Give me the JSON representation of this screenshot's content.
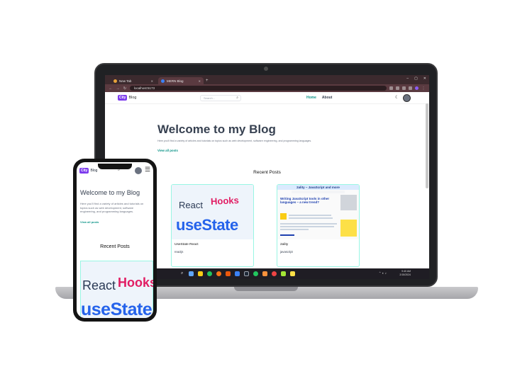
{
  "browser": {
    "tabs": [
      {
        "label": "New Tab"
      },
      {
        "label": "MERN Blog"
      }
    ],
    "url": "localhost:5173"
  },
  "site": {
    "logo_badge": "City",
    "logo_text": "Blog",
    "search_placeholder": "Search...",
    "nav": {
      "home": "Home",
      "about": "About"
    },
    "hero": {
      "title": "Welcome to my Blog",
      "subtitle": "Here you'll find a variety of articles and tutorials on topics such as web development, software engineering, and programming languages.",
      "link": "View all posts"
    },
    "recent_title": "Recent Posts",
    "posts": [
      {
        "image_react": "React",
        "image_hooks": "Hooks",
        "image_usestate": "useState",
        "title": "UseState React",
        "category": "reactjs"
      },
      {
        "image_header": "2ality – JavaScript and more",
        "image_heading": "Writing JavaScript tools in other languages – a new trend?",
        "title": "2ality",
        "category": "javascript"
      }
    ]
  },
  "taskbar": {
    "time": "9:40 AM",
    "date": "2/15/2024"
  },
  "colors": {
    "accent": "#0d9488",
    "logo": "#7c3aed",
    "hooks": "#e11d63",
    "usestate": "#2563eb"
  }
}
